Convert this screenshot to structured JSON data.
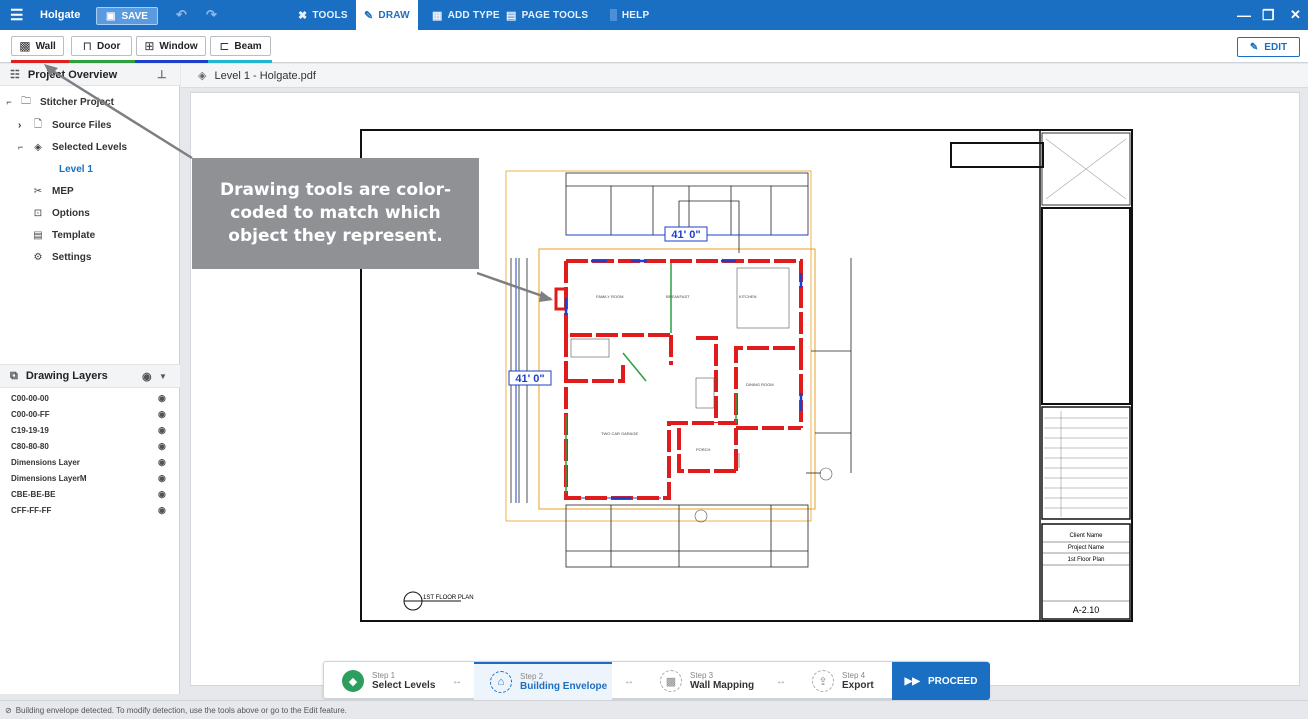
{
  "topbar": {
    "title": "Holgate",
    "save": "SAVE",
    "menu": [
      {
        "label": "TOOLS"
      },
      {
        "label": "DRAW"
      },
      {
        "label": "ADD TYPE"
      },
      {
        "label": "PAGE TOOLS"
      },
      {
        "label": "HELP"
      }
    ]
  },
  "toolbar": {
    "tools": [
      {
        "label": "Wall",
        "color": "#e02020"
      },
      {
        "label": "Door",
        "color": "#2e9e3e"
      },
      {
        "label": "Window",
        "color": "#1e3fc9"
      },
      {
        "label": "Beam",
        "color": "#22b6d0"
      }
    ],
    "edit": "EDIT"
  },
  "sidebar": {
    "project_overview": "Project Overview",
    "tree": [
      {
        "label": "Stitcher Project",
        "icon": "folder-icon"
      },
      {
        "label": "Source Files",
        "icon": "file-icon"
      },
      {
        "label": "Selected Levels",
        "icon": "layers-icon"
      },
      {
        "label": "Level 1"
      },
      {
        "label": "MEP",
        "icon": "tools-icon"
      },
      {
        "label": "Options",
        "icon": "options-icon"
      },
      {
        "label": "Template",
        "icon": "template-icon"
      },
      {
        "label": "Settings",
        "icon": "settings-icon"
      }
    ],
    "drawing_layers": "Drawing Layers",
    "layers": [
      "C00-00-00",
      "C00-00-FF",
      "C19-19-19",
      "C80-80-80",
      "Dimensions Layer",
      "Dimensions LayerM",
      "CBE-BE-BE",
      "CFF-FF-FF"
    ]
  },
  "document": {
    "title": "Level 1 - Holgate.pdf"
  },
  "drawing": {
    "dimension_top": "41' 0\"",
    "dimension_left": "41' 0\"",
    "plan_label": "1ST FLOOR PLAN",
    "sheet": "A-2.10",
    "client": "Client Name",
    "project": "Project Name",
    "floor": "1st Floor Plan"
  },
  "callout": "Drawing tools are color-coded to match which object they represent.",
  "steps": [
    {
      "num": "Step 1",
      "label": "Select Levels"
    },
    {
      "num": "Step 2",
      "label": "Building Envelope"
    },
    {
      "num": "Step 3",
      "label": "Wall Mapping"
    },
    {
      "num": "Step 4",
      "label": "Export"
    }
  ],
  "proceed": "PROCEED",
  "status": "Building envelope detected. To modify detection, use the tools above or go to the Edit feature."
}
